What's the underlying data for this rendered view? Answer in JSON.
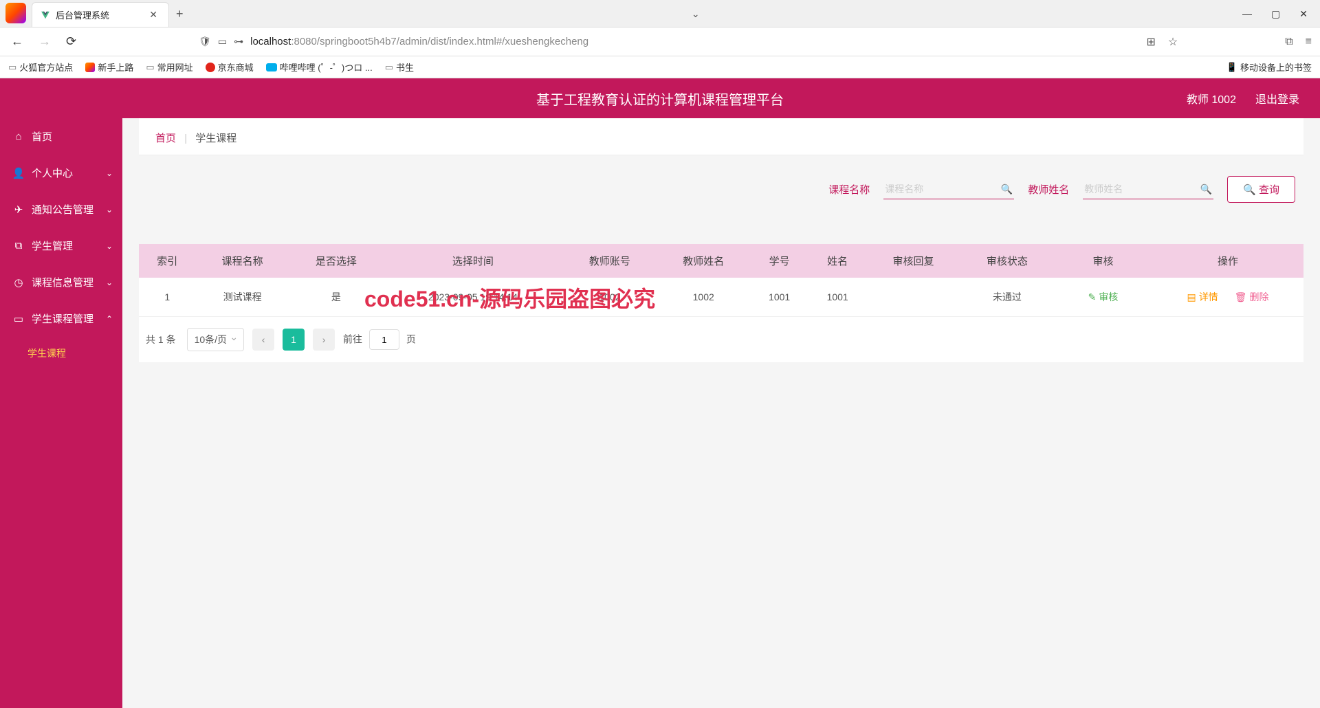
{
  "browser": {
    "tab_title": "后台管理系统",
    "url_prefix": "localhost",
    "url_path": ":8080/springboot5h4b7/admin/dist/index.html#/xueshengkecheng"
  },
  "bookmarks": {
    "b1": "火狐官方站点",
    "b2": "新手上路",
    "b3": "常用网址",
    "b4": "京东商城",
    "b5": "哔哩哔哩 (゜-゜)つロ ...",
    "b6": "书生",
    "right": "移动设备上的书签"
  },
  "header": {
    "title": "基于工程教育认证的计算机课程管理平台",
    "user": "教师 1002",
    "logout": "退出登录"
  },
  "sidebar": {
    "home": "首页",
    "personal": "个人中心",
    "notice": "通知公告管理",
    "student": "学生管理",
    "course_info": "课程信息管理",
    "student_course": "学生课程管理",
    "sub_student_course": "学生课程"
  },
  "breadcrumb": {
    "home": "首页",
    "current": "学生课程"
  },
  "filter": {
    "course_name_label": "课程名称",
    "course_name_placeholder": "课程名称",
    "teacher_name_label": "教师姓名",
    "teacher_name_placeholder": "教师姓名",
    "query": "查询"
  },
  "table": {
    "headers": {
      "index": "索引",
      "course_name": "课程名称",
      "selected": "是否选择",
      "select_time": "选择时间",
      "teacher_acct": "教师账号",
      "teacher_name": "教师姓名",
      "stu_no": "学号",
      "stu_name": "姓名",
      "reply": "审核回复",
      "status": "审核状态",
      "audit": "审核",
      "ops": "操作"
    },
    "rows": [
      {
        "index": "1",
        "course_name": "测试课程",
        "selected": "是",
        "select_time": "2023-09-05 19:14:14",
        "teacher_acct": "1002",
        "teacher_name": "1002",
        "stu_no": "1001",
        "stu_name": "1001",
        "reply": "",
        "status": "未通过"
      }
    ],
    "audit_label": "审核",
    "detail_label": "详情",
    "delete_label": "删除"
  },
  "pagination": {
    "total_text": "共 1 条",
    "page_size": "10条/页",
    "current": "1",
    "jump_prefix": "前往",
    "jump_value": "1",
    "jump_suffix": "页"
  },
  "watermark": "code51.cn-源码乐园盗图必究"
}
